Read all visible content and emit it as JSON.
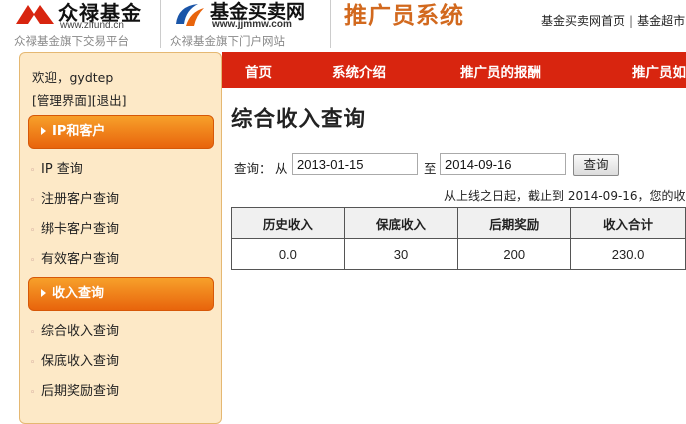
{
  "header": {
    "logo1": {
      "name": "众禄基金",
      "url": "www.zlfund.cn",
      "tagline": "众禄基金旗下交易平台"
    },
    "logo2": {
      "name": "基金买卖网",
      "url": "www.jjmmw.com",
      "tagline": "众禄基金旗下门户网站"
    },
    "system_title": "推广员系统",
    "top_links": [
      "基金买卖网首页",
      "基金超市"
    ],
    "brand_color": "#d8250f",
    "title_color": "#d2691e"
  },
  "nav": {
    "items": [
      "首页",
      "系统介绍",
      "推广员的报酬",
      "推广员如"
    ]
  },
  "sidebar": {
    "welcome": "欢迎，gydtep",
    "admin_link": "[管理界面]",
    "logout_link": "[退出]",
    "sections": [
      {
        "title": "IP和客户",
        "items": [
          "IP 查询",
          "注册客户查询",
          "绑卡客户查询",
          "有效客户查询"
        ]
      },
      {
        "title": "收入查询",
        "items": [
          "综合收入查询",
          "保底收入查询",
          "后期奖励查询"
        ]
      }
    ]
  },
  "main": {
    "title": "综合收入查询",
    "query": {
      "label": "查询：",
      "from_label": "从",
      "from_value": "2013-01-15",
      "to_label": "至",
      "to_value": "2014-09-16",
      "button": "查询"
    },
    "summary_note": "从上线之日起，截止到 2014-09-16，您的收",
    "table": {
      "headers": [
        "历史收入",
        "保底收入",
        "后期奖励",
        "收入合计"
      ],
      "rows": [
        [
          "0.0",
          "30",
          "200",
          "230.0"
        ]
      ]
    }
  }
}
